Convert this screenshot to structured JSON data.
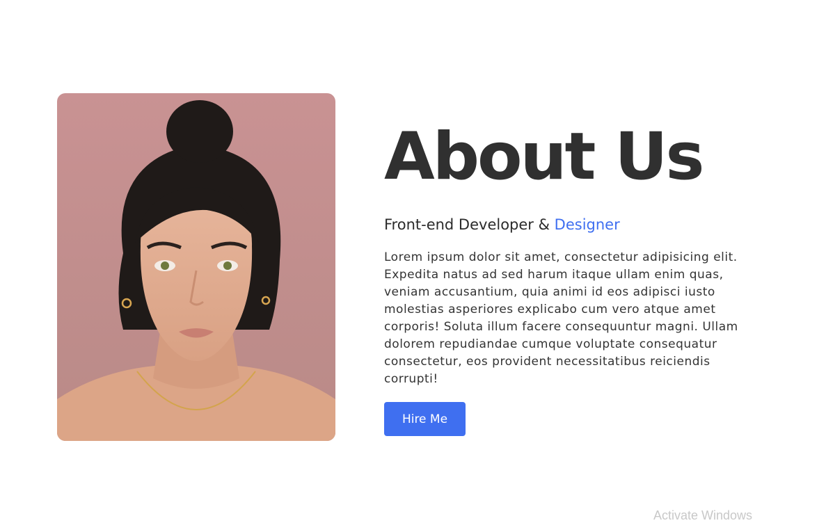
{
  "about": {
    "title": "About Us",
    "subtitle_prefix": "Front-end Developer & ",
    "subtitle_accent": "Designer",
    "description": "Lorem ipsum dolor sit amet, consectetur adipisicing elit. Expedita natus ad sed harum itaque ullam enim quas, veniam accusantium, quia animi id eos adipisci iusto molestias asperiores explicabo cum vero atque amet corporis! Soluta illum facere consequuntur magni. Ullam dolorem repudiandae cumque voluptate consequatur consectetur, eos provident necessitatibus reiciendis corrupti!",
    "button_label": "Hire Me"
  },
  "watermark": {
    "text": "Activate Windows"
  },
  "colors": {
    "accent": "#3f6ff0",
    "title": "#303030",
    "portrait_background": "#c99090"
  }
}
